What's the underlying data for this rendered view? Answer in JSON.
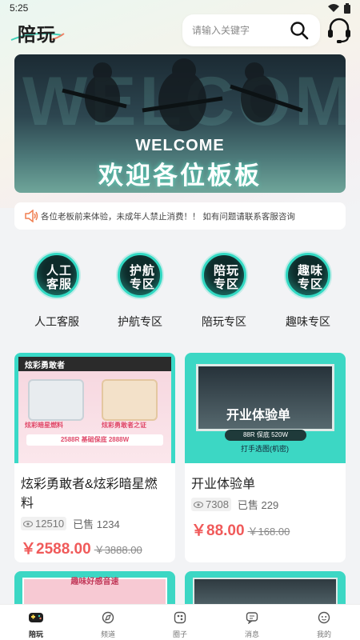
{
  "status": {
    "time": "5:25"
  },
  "header": {
    "logo": "陪玩",
    "search_placeholder": "请输入关键字"
  },
  "banner": {
    "bg_word": "WELCOME",
    "welcome": "WELCOME",
    "title": "欢迎各位板板"
  },
  "notice": {
    "text": "各位老板前来体验，未成年人禁止消费！！ 如有问题请联系客服咨询"
  },
  "categories": [
    {
      "circle": "人工\n客服",
      "label": "人工客服",
      "circle_top": "人工",
      "circle_bottom": "客服"
    },
    {
      "circle": "护航\n专区",
      "label": "护航专区",
      "circle_top": "护航",
      "circle_bottom": "专区"
    },
    {
      "circle": "陪玩\n专区",
      "label": "陪玩专区",
      "circle_top": "陪玩",
      "circle_bottom": "专区"
    },
    {
      "circle": "趣味\n专区",
      "label": "趣味专区",
      "circle_top": "趣味",
      "circle_bottom": "专区"
    }
  ],
  "products": [
    {
      "name": "炫彩勇敢者&炫彩暗星燃料",
      "views": "12510",
      "sold": "已售 1234",
      "price": "￥2588.00",
      "old_price": "￥3888.00",
      "img_title": "炫彩勇敢者",
      "img_text1": "炫彩暗星燃料",
      "img_text2": "炫彩勇敢者之证",
      "img_text3": "2588R 基础保底 2888W"
    },
    {
      "name": "开业体验单",
      "views": "7308",
      "sold": "已售 229",
      "price": "￥88.00",
      "old_price": "￥168.00",
      "img_title": "开业体验单",
      "img_pill": "88R 保底 520W",
      "img_sub": "打手选图(机密)"
    }
  ],
  "partial_cards": [
    {
      "img_text": "趣味好感音速"
    },
    {
      "img_text": ""
    }
  ],
  "tabs": [
    {
      "label": "陪玩",
      "icon": "gamepad-icon",
      "active": true
    },
    {
      "label": "频道",
      "icon": "channel-icon",
      "active": false
    },
    {
      "label": "圈子",
      "icon": "circle-icon",
      "active": false
    },
    {
      "label": "消息",
      "icon": "message-icon",
      "active": false
    },
    {
      "label": "我的",
      "icon": "profile-icon",
      "active": false
    }
  ],
  "colors": {
    "accent": "#33d9c3",
    "price": "#f05a5a"
  }
}
